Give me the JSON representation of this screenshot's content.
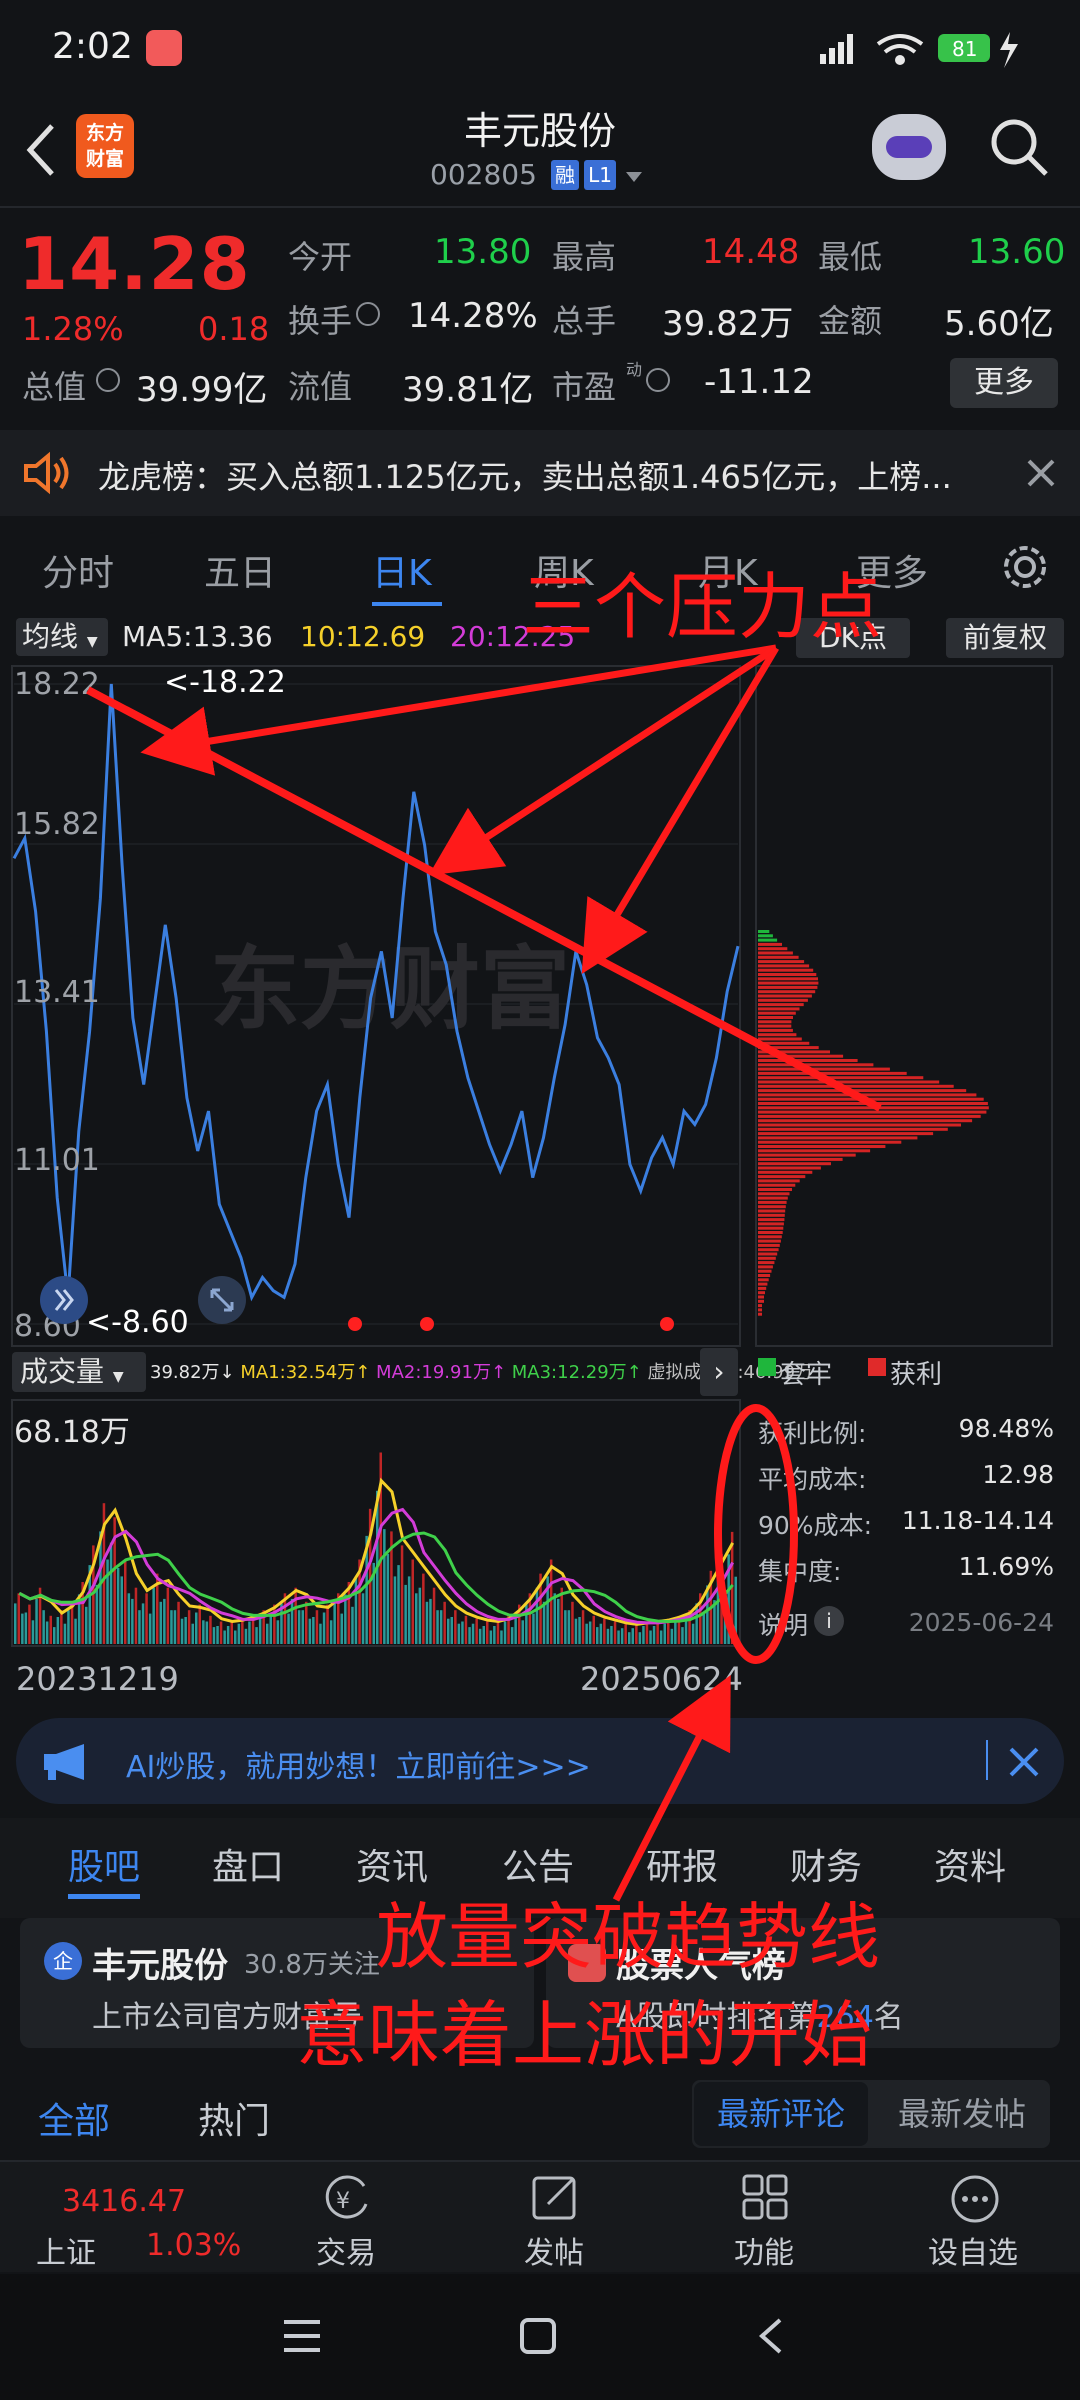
{
  "status_bar": {
    "time": "2:02",
    "battery": "81"
  },
  "header": {
    "logo_line1": "东方",
    "logo_line2": "财富",
    "title": "丰元股份",
    "code": "002805",
    "badge_rong": "融",
    "badge_l1": "L1"
  },
  "quote": {
    "price": "14.28",
    "change_pct": "1.28%",
    "change_abs": "0.18",
    "open_label": "今开",
    "open": "13.80",
    "high_label": "最高",
    "high": "14.48",
    "low_label": "最低",
    "low": "13.60",
    "turnover_label": "换手",
    "turnover": "14.28%",
    "volume_label": "总手",
    "volume": "39.82万",
    "amount_label": "金额",
    "amount": "5.60亿",
    "mcap_label": "总值",
    "mcap": "39.99亿",
    "float_label": "流值",
    "float": "39.81亿",
    "pe_label": "市盈",
    "pe_sup": "动",
    "pe": "-11.12",
    "more_button": "更多"
  },
  "notice": {
    "text": "龙虎榜：买入总额1.125亿元，卖出总额1.465亿元，上榜..."
  },
  "chart_tabs": [
    "分时",
    "五日",
    "日K",
    "周K",
    "月K",
    "更多"
  ],
  "ma_bar": {
    "dropdown": "均线",
    "ma5": "MA5:13.36",
    "ma10": "10:12.69",
    "ma20": "20:12.25",
    "dk": "DK点",
    "fq": "前复权"
  },
  "price_axis": {
    "t1": "18.22",
    "t2": "15.82",
    "t3": "13.41",
    "t4": "11.01",
    "t5": "8.60",
    "max_marker": "<-18.22",
    "min_marker": "<-8.60"
  },
  "watermark": "东方财富",
  "annotations": {
    "pressure": "三个压力点",
    "breakout_line1": "放量突破趋势线",
    "breakout_line2": "意味着上涨的开始"
  },
  "volume_bar": {
    "dropdown": "成交量",
    "v": "39.82万",
    "ma1": "MA1:32.54万",
    "ma2": "MA2:19.91万",
    "ma3": "MA3:12.29万",
    "virtual": "虚拟成交量:46.99万",
    "max": "68.18万",
    "date_start": "20231219",
    "date_end": "20250624"
  },
  "chip": {
    "legend_trapped": "套牢",
    "legend_profit": "获利",
    "rows": [
      {
        "label": "获利比例:",
        "value": "98.48%"
      },
      {
        "label": "平均成本:",
        "value": "12.98"
      },
      {
        "label": "90%成本:",
        "value": "11.18-14.14"
      },
      {
        "label": "集中度:",
        "value": "11.69%"
      }
    ],
    "note_label": "说明",
    "date": "2025-06-24"
  },
  "ai_banner": {
    "text": "AI炒股，就用妙想！立即前往>>>"
  },
  "bottom_tabs": [
    "股吧",
    "盘口",
    "资讯",
    "公告",
    "研报",
    "财务",
    "资料"
  ],
  "cards": {
    "left_name": "丰元股份",
    "left_followers": "30.8万关注",
    "left_sub": "上市公司官方财富号",
    "right_title": "股票人气榜",
    "right_sub_pre": "A股即时排名第",
    "right_rank": "264",
    "right_sub_post": "名"
  },
  "filters": {
    "all": "全部",
    "hot": "热门",
    "latest_comment": "最新评论",
    "latest_post": "最新发帖"
  },
  "bottom_nav": {
    "index_value": "3416.47",
    "index_name": "上证",
    "index_pct": "1.03%",
    "trade": "交易",
    "post": "发帖",
    "func": "功能",
    "fav": "设自选"
  },
  "chart_data": [
    {
      "type": "line",
      "title": "日K",
      "x_range": [
        "20231219",
        "20250624"
      ],
      "ylim": [
        8.6,
        18.22
      ],
      "y_ticks": [
        18.22,
        15.82,
        13.41,
        11.01,
        8.6
      ],
      "series": [
        {
          "values": [
            15.6,
            15.9,
            14.8,
            13.0,
            10.5,
            9.0,
            11.5,
            13.0,
            15.0,
            18.22,
            15.5,
            13.2,
            12.2,
            13.4,
            14.6,
            13.5,
            12.0,
            11.2,
            11.8,
            10.4,
            10.0,
            9.6,
            9.0,
            9.3,
            9.1,
            9.0,
            9.5,
            10.8,
            11.8,
            12.2,
            11.0,
            10.2,
            12.0,
            13.5,
            14.2,
            13.2,
            15.0,
            16.6,
            15.8,
            14.5,
            14.0,
            13.0,
            12.3,
            11.8,
            11.3,
            10.9,
            11.3,
            11.8,
            10.8,
            11.4,
            12.3,
            13.1,
            14.2,
            13.7,
            12.9,
            12.6,
            12.2,
            11.0,
            10.6,
            11.1,
            11.4,
            11.0,
            11.8,
            11.6,
            11.9,
            12.6,
            13.6,
            14.28
          ]
        }
      ]
    },
    {
      "type": "bar",
      "title": "成交量",
      "ylim": [
        0,
        68.18
      ],
      "y_unit": "万",
      "series": [
        {
          "name": "成交量",
          "values": [
            18,
            14,
            20,
            10,
            12,
            15,
            22,
            35,
            50,
            45,
            30,
            20,
            18,
            25,
            20,
            15,
            12,
            14,
            10,
            8,
            8,
            9,
            10,
            12,
            14,
            18,
            20,
            15,
            12,
            14,
            18,
            22,
            30,
            48,
            68,
            40,
            35,
            30,
            25,
            20,
            15,
            12,
            10,
            9,
            8,
            8,
            10,
            14,
            18,
            25,
            30,
            20,
            15,
            12,
            10,
            9,
            8,
            7,
            7,
            8,
            8,
            9,
            10,
            12,
            18,
            26,
            32,
            39.82
          ]
        }
      ]
    }
  ]
}
